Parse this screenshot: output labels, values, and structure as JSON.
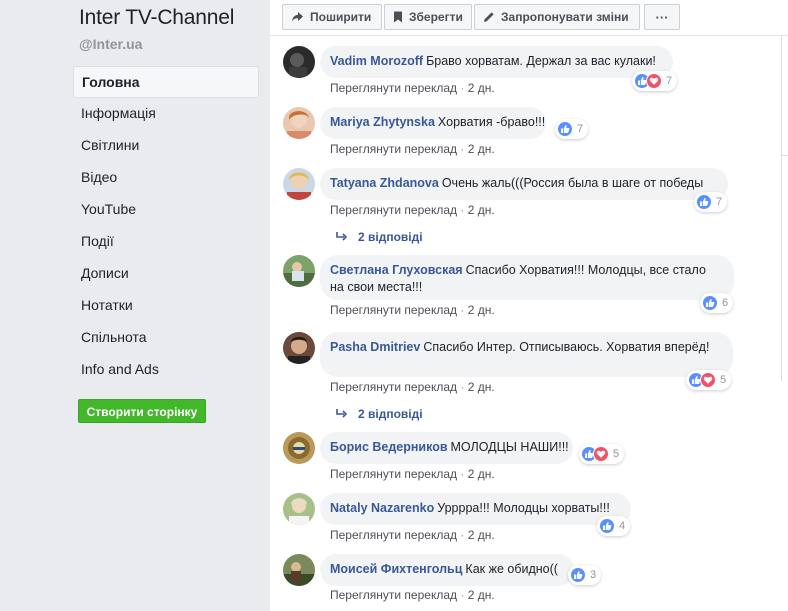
{
  "page": {
    "title": "Inter TV-Channel",
    "handle": "@Inter.ua"
  },
  "nav": {
    "items": [
      {
        "label": "Головна",
        "active": true
      },
      {
        "label": "Інформація"
      },
      {
        "label": "Світлини"
      },
      {
        "label": "Відео"
      },
      {
        "label": "YouTube"
      },
      {
        "label": "Події"
      },
      {
        "label": "Дописи"
      },
      {
        "label": "Нотатки"
      },
      {
        "label": "Спільнота"
      },
      {
        "label": "Info and Ads"
      }
    ],
    "create_page": "Створити сторінку"
  },
  "actions": {
    "share": "Поширити",
    "save": "Зберегти",
    "suggest_edits": "Запропонувати зміни",
    "more": "···"
  },
  "comment_meta": {
    "see_translation": "Переглянути переклад",
    "separator": "·"
  },
  "comments": [
    {
      "author": "Vadim Morozoff",
      "text": "Браво хорватам. Держал за вас кулаки!",
      "time": "2 дн.",
      "reactions": 7,
      "reaction_types": [
        "like",
        "love"
      ]
    },
    {
      "author": "Mariya Zhytynska",
      "text": "Хорватия -браво!!!",
      "time": "2 дн.",
      "reactions": 7,
      "reaction_types": [
        "like"
      ]
    },
    {
      "author": "Tatyana Zhdanova",
      "text": "Очень жаль(((Россия была в шаге от победы",
      "time": "2 дн.",
      "reactions": 7,
      "reaction_types": [
        "like"
      ],
      "replies": "2 відповіді"
    },
    {
      "author": "Светлана Глуховская",
      "text": "Спасибо Хорватия!!! Молодцы, все стало на свои места!!!",
      "time": "2 дн.",
      "reactions": 6,
      "reaction_types": [
        "like"
      ]
    },
    {
      "author": "Pasha Dmitriev",
      "text": "Спасибо Интер. Отписываюсь. Хорватия вперёд!",
      "time": "2 дн.",
      "reactions": 5,
      "reaction_types": [
        "like",
        "love"
      ],
      "replies": "2 відповіді"
    },
    {
      "author": "Борис Ведерников",
      "text": "МОЛОДЦЫ НАШИ!!!",
      "time": "2 дн.",
      "reactions": 5,
      "reaction_types": [
        "like",
        "love"
      ]
    },
    {
      "author": "Nataly Nazarenko",
      "text": "Урррра!!! Молодцы хорваты!!!",
      "time": "2 дн.",
      "reactions": 4,
      "reaction_types": [
        "like"
      ]
    },
    {
      "author": "Моисей Фихтенгольц",
      "text": "Как же обидно((",
      "time": "2 дн.",
      "reactions": 3,
      "reaction_types": [
        "like"
      ]
    }
  ],
  "colors": {
    "background": "#e9ebee",
    "link": "#385898",
    "like": "#5890ff",
    "love": "#f25268",
    "create_button": "#42b72a"
  }
}
